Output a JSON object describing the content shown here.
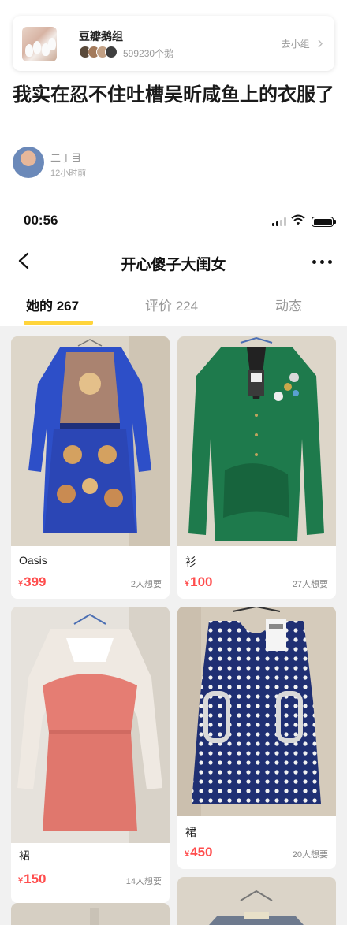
{
  "group": {
    "name": "豆瓣鹅组",
    "members": "599230个鹅",
    "link": "去小组"
  },
  "post": {
    "title": "我实在忍不住吐槽吴昕咸鱼上的衣服了",
    "author": "二丁目",
    "time": "12小时前"
  },
  "status_bar": {
    "time": "00:56"
  },
  "nav": {
    "title": "开心傻子大闺女"
  },
  "tabs": [
    {
      "label": "她的 267",
      "active": true
    },
    {
      "label": "评价 224",
      "active": false
    },
    {
      "label": "动态",
      "active": false
    }
  ],
  "items": [
    {
      "title": "Oasis",
      "price_symbol": "¥",
      "price": "399",
      "wants": "2人想要"
    },
    {
      "title": "衫",
      "price_symbol": "¥",
      "price": "100",
      "wants": "27人想要"
    },
    {
      "title": "裙",
      "price_symbol": "¥",
      "price": "150",
      "wants": "14人想要"
    },
    {
      "title": "裙",
      "price_symbol": "¥",
      "price": "450",
      "wants": "20人想要"
    }
  ],
  "colors": {
    "accent": "#ffd43b",
    "price": "#ff4d4d"
  }
}
